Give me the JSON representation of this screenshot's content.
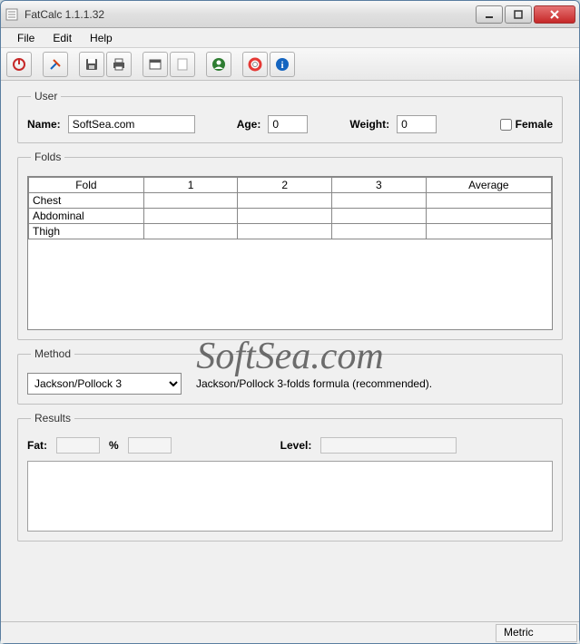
{
  "window": {
    "title": "FatCalc 1.1.1.32"
  },
  "menu": {
    "file": "File",
    "edit": "Edit",
    "help": "Help"
  },
  "user": {
    "legend": "User",
    "name_label": "Name:",
    "name_value": "SoftSea.com",
    "age_label": "Age:",
    "age_value": "0",
    "weight_label": "Weight:",
    "weight_value": "0",
    "female_label": "Female"
  },
  "folds": {
    "legend": "Folds",
    "headers": [
      "Fold",
      "1",
      "2",
      "3",
      "Average"
    ],
    "rows": [
      {
        "label": "Chest",
        "v1": "",
        "v2": "",
        "v3": "",
        "avg": ""
      },
      {
        "label": "Abdominal",
        "v1": "",
        "v2": "",
        "v3": "",
        "avg": ""
      },
      {
        "label": "Thigh",
        "v1": "",
        "v2": "",
        "v3": "",
        "avg": ""
      }
    ]
  },
  "method": {
    "legend": "Method",
    "selected": "Jackson/Pollock 3",
    "description": "Jackson/Pollock 3-folds formula (recommended)."
  },
  "results": {
    "legend": "Results",
    "fat_label": "Fat:",
    "fat_value": "",
    "percent_label": "%",
    "percent_value": "",
    "level_label": "Level:",
    "level_value": ""
  },
  "status": {
    "metric": "Metric"
  },
  "watermark": "SoftSea.com"
}
